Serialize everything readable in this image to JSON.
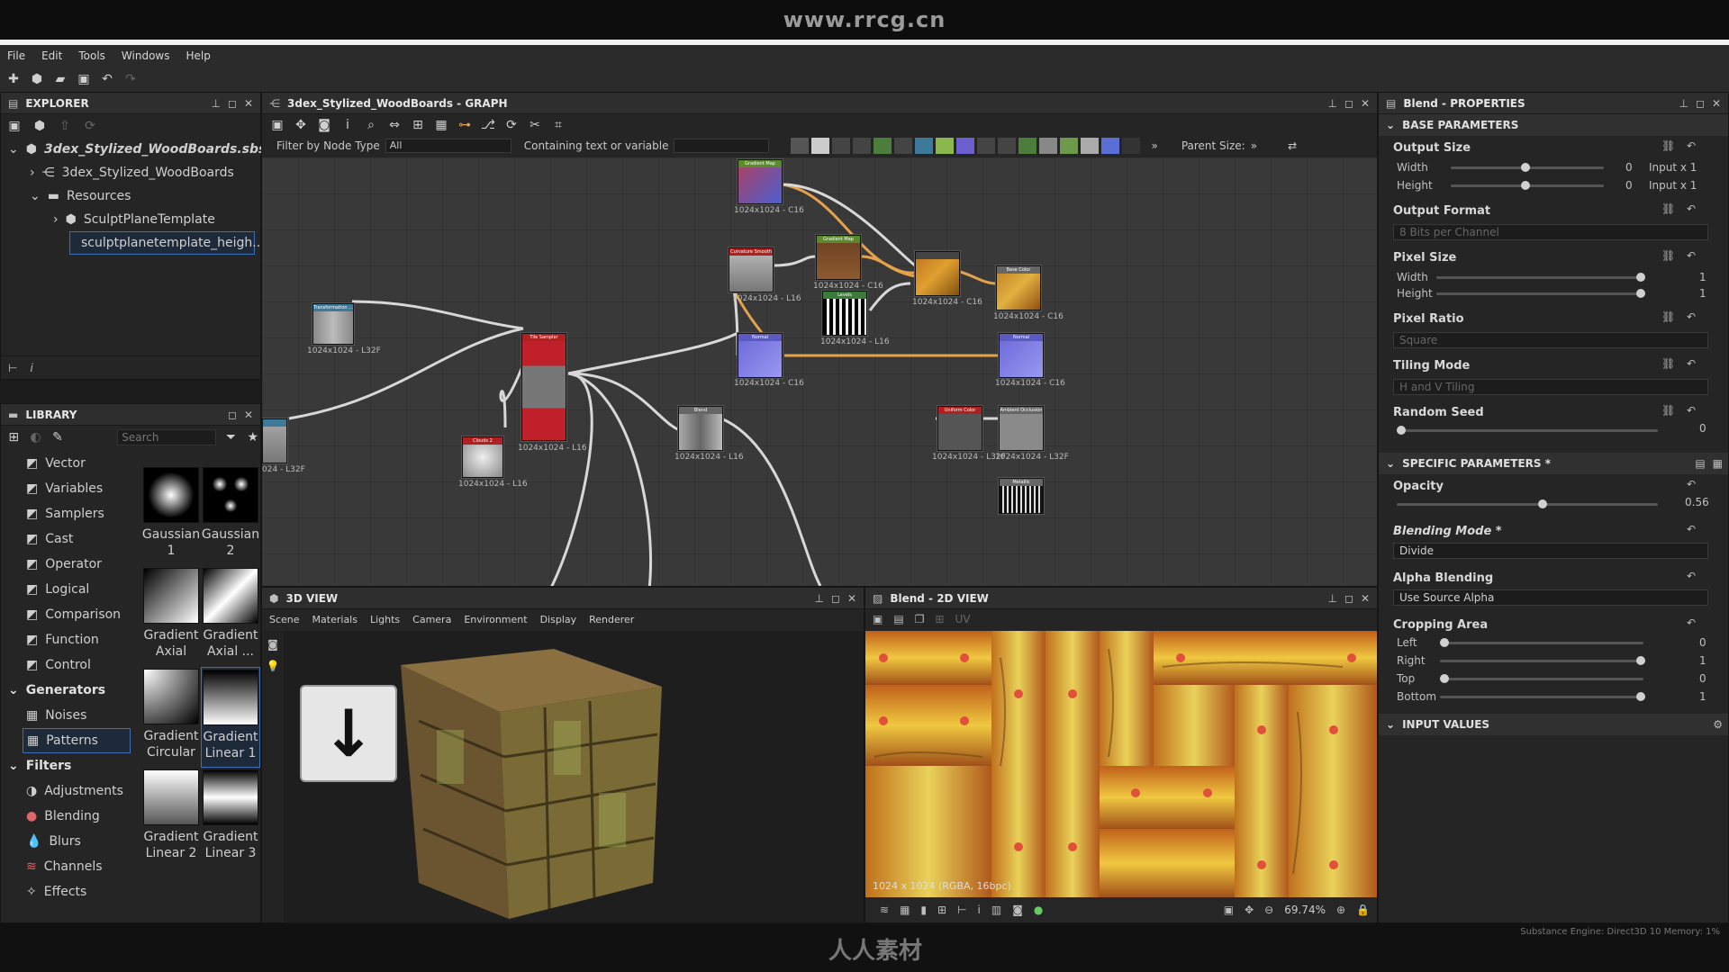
{
  "watermark": {
    "top_url": "www.rrcg.cn",
    "bottom": "人人素材"
  },
  "menu": [
    "File",
    "Edit",
    "Tools",
    "Windows",
    "Help"
  ],
  "explorer": {
    "title": "EXPLORER",
    "package": "3dex_Stylized_WoodBoards.sbs*",
    "graph_item": "3dex_Stylized_WoodBoards",
    "resources": "Resources",
    "template": "SculptPlaneTemplate",
    "selected_file": "sculptplanetemplate_heigh..."
  },
  "library": {
    "title": "LIBRARY",
    "search_placeholder": "Search",
    "categories": [
      "Vector",
      "Variables",
      "Samplers",
      "Cast",
      "Operator",
      "Logical",
      "Comparison",
      "Function",
      "Control"
    ],
    "generators": {
      "label": "Generators",
      "items": [
        "Noises",
        "Patterns"
      ]
    },
    "filters": {
      "label": "Filters",
      "items": [
        "Adjustments",
        "Blending",
        "Blurs",
        "Channels",
        "Effects"
      ]
    },
    "thumbs": [
      {
        "l1": "Gaussian",
        "l2": "1"
      },
      {
        "l1": "Gaussian",
        "l2": "2"
      },
      {
        "l1": "Gradient",
        "l2": "Axial"
      },
      {
        "l1": "Gradient",
        "l2": "Axial ..."
      },
      {
        "l1": "Gradient",
        "l2": "Circular"
      },
      {
        "l1": "Gradient",
        "l2": "Linear 1"
      },
      {
        "l1": "Gradient",
        "l2": "Linear 2"
      },
      {
        "l1": "Gradient",
        "l2": "Linear 3"
      }
    ]
  },
  "graph": {
    "title": "3dex_Stylized_WoodBoards - GRAPH",
    "filter_label": "Filter by Node Type",
    "filter_value": "All",
    "containing_label": "Containing text or variable",
    "parent_size": "Parent Size:",
    "nodes": {
      "n1": {
        "title": "Gradient Map",
        "size": "1024x1024 - C16"
      },
      "n2": {
        "title": "Curvature Smooth",
        "size": "1024x1024 - L16"
      },
      "n3": {
        "title": "Gradient Map",
        "size": "1024x1024 - C16"
      },
      "n4": {
        "title": "",
        "size": "1024x1024 - C16"
      },
      "n5": {
        "title": "Base Color",
        "size": "1024x1024 - C16"
      },
      "n6": {
        "title": "Levels",
        "size": "1024x1024 - L16"
      },
      "n7": {
        "title": "Transformation ...",
        "size": "1024x1024 - L32F"
      },
      "n8": {
        "title": "Tile Sampler",
        "size": "1024x1024 - L16"
      },
      "n9": {
        "title": "Normal",
        "size": "1024x1024 - C16"
      },
      "n10": {
        "title": "Normal",
        "size": "1024x1024 - C16"
      },
      "n11": {
        "title": "Blend",
        "size": "1024x1024 - L16"
      },
      "n12": {
        "title": "Uniform Color",
        "size": "1024x1024 - L32F"
      },
      "n13": {
        "title": "Ambient Occlusion",
        "size": "1024x1024 - L32F"
      },
      "n14": {
        "title": "Clouds 2",
        "size": "1024x1024 - L16"
      },
      "n15": {
        "title": "",
        "size": "024 - L32F"
      },
      "n16": {
        "title": "Metallic",
        "size": ""
      }
    }
  },
  "view3d": {
    "title": "3D VIEW",
    "menu": [
      "Scene",
      "Materials",
      "Lights",
      "Camera",
      "Environment",
      "Display",
      "Renderer"
    ]
  },
  "view2d": {
    "title": "Blend - 2D VIEW",
    "uv": "UV",
    "info": "1024 x 1024 (RGBA, 16bpc)",
    "zoom": "69.74%"
  },
  "props": {
    "title": "Blend - PROPERTIES",
    "base_section": "BASE PARAMETERS",
    "output_size": "Output Size",
    "width": "Width",
    "height": "Height",
    "w_val": "0",
    "w_mode": "Input x 1",
    "h_val": "0",
    "h_mode": "Input x 1",
    "output_format": "Output Format",
    "output_format_val": "8 Bits per Channel",
    "pixel_size": "Pixel Size",
    "ps_w": "1",
    "ps_h": "1",
    "pixel_ratio": "Pixel Ratio",
    "pixel_ratio_val": "Square",
    "tiling_mode": "Tiling Mode",
    "tiling_mode_val": "H and V Tiling",
    "random_seed": "Random Seed",
    "random_seed_val": "0",
    "specific_section": "SPECIFIC PARAMETERS *",
    "opacity": "Opacity",
    "opacity_val": "0.56",
    "blending_mode": "Blending Mode *",
    "blending_mode_val": "Divide",
    "alpha_blending": "Alpha Blending",
    "alpha_blending_val": "Use Source Alpha",
    "cropping_area": "Cropping Area",
    "left": "Left",
    "right": "Right",
    "top": "Top",
    "bottom": "Bottom",
    "left_val": "0",
    "right_val": "1",
    "top_val": "0",
    "bottom_val": "1",
    "input_values": "INPUT VALUES",
    "opacity_level": 0.56
  },
  "status": {
    "engine": "Substance Engine: Direct3D 10   Memory: 1%"
  },
  "colors": {
    "accent_orange": "#e5a24a",
    "tile_red": "#c0202a",
    "normal_blue": "#7a78d8"
  }
}
